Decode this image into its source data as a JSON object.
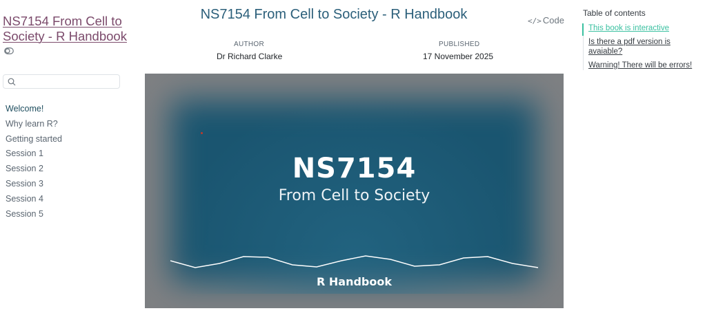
{
  "sidebar": {
    "book_title": "NS7154 From Cell to Society - R Handbook",
    "search": {
      "placeholder": "",
      "value": ""
    },
    "nav_items": [
      {
        "label": "Welcome!"
      },
      {
        "label": "Why learn R?"
      },
      {
        "label": "Getting started"
      },
      {
        "label": "Session 1"
      },
      {
        "label": "Session 2"
      },
      {
        "label": "Session 3"
      },
      {
        "label": "Session 4"
      },
      {
        "label": "Session 5"
      }
    ]
  },
  "header": {
    "title": "NS7154 From Cell to Society - R Handbook",
    "code_button": "Code",
    "author_label": "AUTHOR",
    "author": "Dr Richard Clarke",
    "published_label": "PUBLISHED",
    "published": "17 November 2025"
  },
  "banner": {
    "code": "NS7154",
    "subtitle": "From Cell to Society",
    "footer": "R Handbook"
  },
  "toc": {
    "title": "Table of contents",
    "items": [
      {
        "label": "This book is interactive"
      },
      {
        "label": "Is there a pdf version is avaiable?"
      },
      {
        "label": "Warning! There will be errors!"
      }
    ]
  },
  "colors": {
    "accent": "#39c0a0",
    "title": "#2b5f7a",
    "book_title": "#7b4a6b",
    "banner_bg": "#1a5570"
  }
}
